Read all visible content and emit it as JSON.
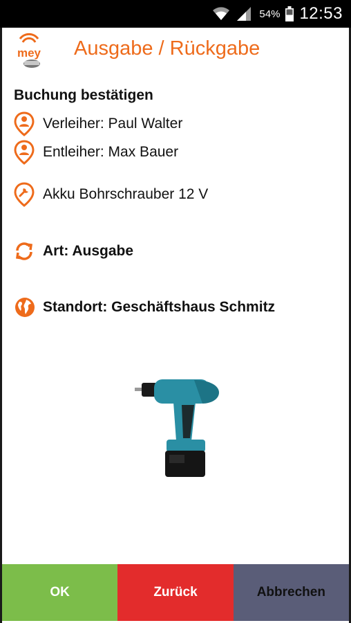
{
  "statusbar": {
    "battery_percent": "54%",
    "time": "12:53"
  },
  "header": {
    "logo_icon": "mey-logo-icon",
    "title": "Ausgabe / Rückgabe"
  },
  "booking": {
    "heading": "Buchung bestätigen",
    "lender": "Verleiher: Paul Walter",
    "borrower": "Entleiher: Max Bauer",
    "item": "Akku Bohrschrauber 12 V",
    "type": "Art: Ausgabe",
    "location": "Standort: Geschäftshaus Schmitz"
  },
  "icons": {
    "lender": "person-pin-icon",
    "borrower": "person-pin-icon",
    "item": "wrench-pin-icon",
    "type": "sync-arrows-icon",
    "location": "globe-icon"
  },
  "buttons": {
    "ok": "OK",
    "back": "Zurück",
    "cancel": "Abbrechen"
  },
  "colors": {
    "accent": "#ee6b1b",
    "ok": "#7cbd4a",
    "back": "#e32c2c",
    "cancel": "#5a5d78"
  }
}
